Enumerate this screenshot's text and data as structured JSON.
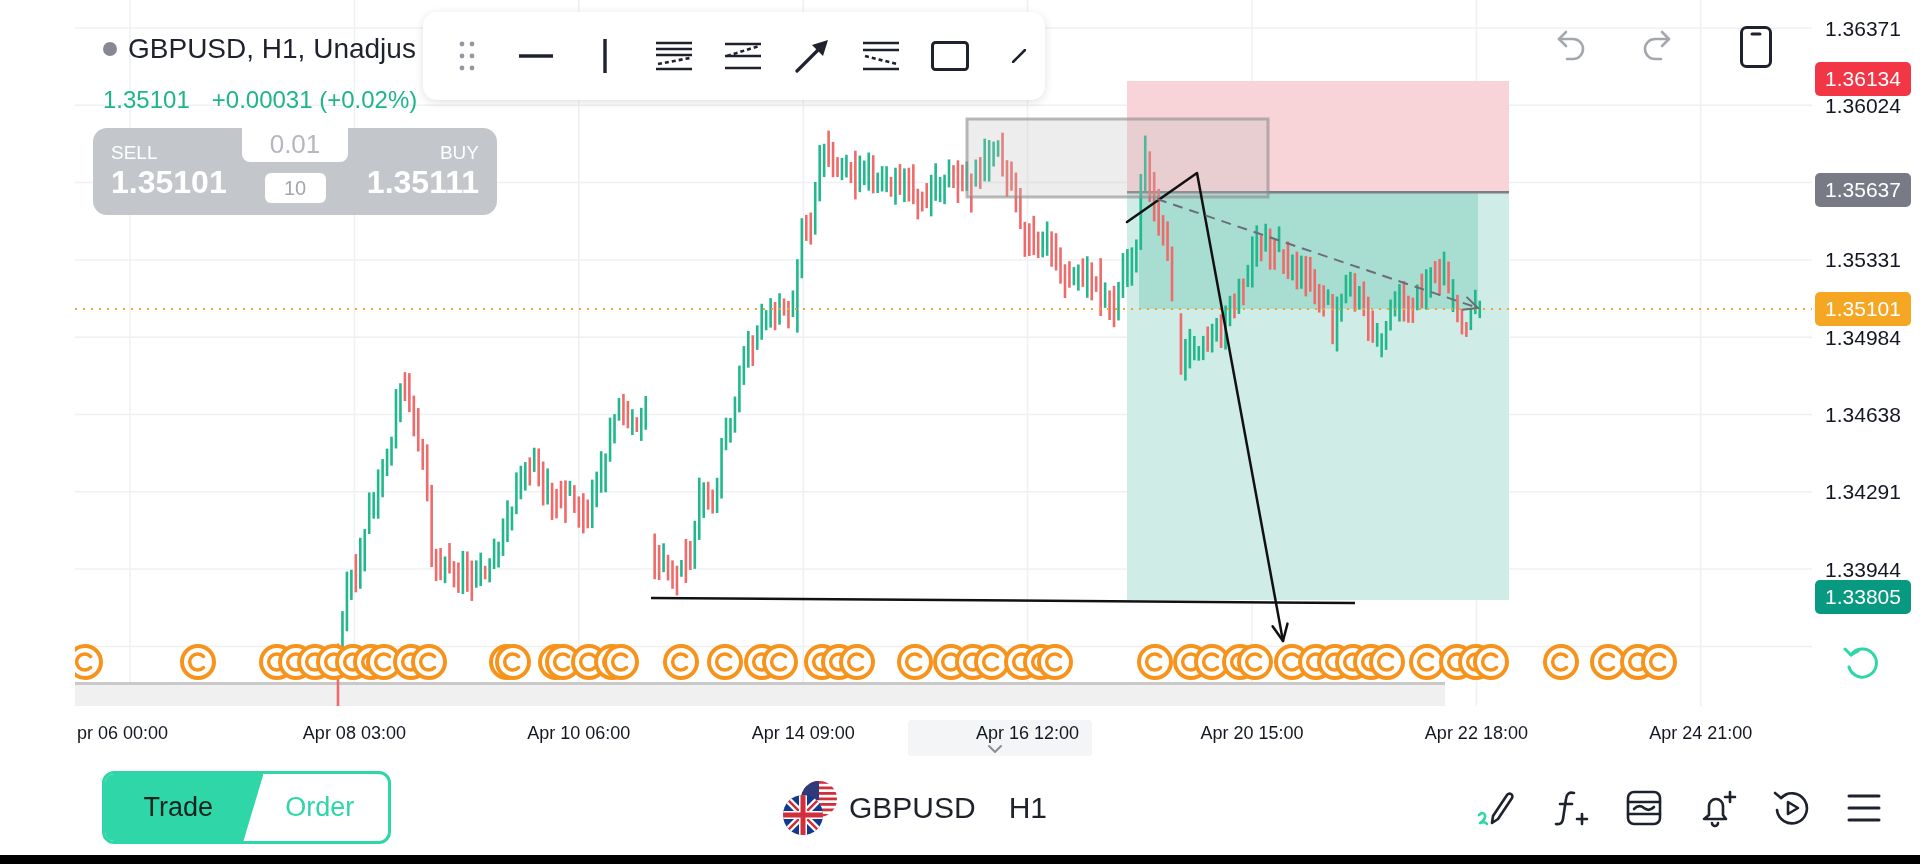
{
  "legend": {
    "title": "GBPUSD, H1, Unadjus",
    "price": "1.35101",
    "change": "+0.00031 (+0.02%)"
  },
  "order_panel": {
    "sell": {
      "label": "SELL",
      "price": "1.35101"
    },
    "lot_size": "0.01",
    "spread": "10",
    "buy": {
      "label": "BUY",
      "price": "1.35111"
    }
  },
  "chart_actions": {
    "undo": {
      "disabled": true
    },
    "redo": {
      "disabled": true
    }
  },
  "price_axis": {
    "labels": [
      "1.36371",
      "1.36024",
      "1.35331",
      "1.34984",
      "1.34638",
      "1.34291",
      "1.33944"
    ],
    "tags": [
      {
        "label": "1.36134",
        "color": "#f23645"
      },
      {
        "label": "1.35637",
        "color": "#787b86"
      },
      {
        "label": "1.35101",
        "color": "#f5a623"
      },
      {
        "label": "1.33805",
        "color": "#089981"
      }
    ]
  },
  "time_axis": {
    "labels": [
      "pr 06 00:00",
      "Apr 08 03:00",
      "Apr 10 06:00",
      "Apr 14 09:00",
      "Apr 16 12:00",
      "Apr 20 15:00",
      "Apr 22 18:00",
      "Apr 24 21:00"
    ]
  },
  "bottom_bar": {
    "mode_tabs": [
      {
        "label": "Trade",
        "selected": true
      },
      {
        "label": "Order",
        "selected": false
      }
    ],
    "symbol": "GBPUSD",
    "interval": "H1"
  }
}
